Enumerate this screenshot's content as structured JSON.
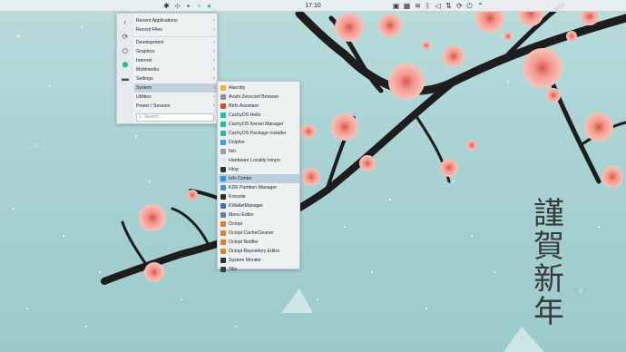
{
  "panel": {
    "clock": "17:10",
    "left_icons": [
      "application-launcher-icon",
      "pin-icon",
      "terminal-icon",
      "window-icon",
      "cachyos-icon"
    ],
    "tray_icons": [
      "clipboard-icon",
      "package-icon",
      "wifi-icon",
      "bluetooth-icon",
      "volume-icon",
      "network-icon",
      "updates-icon",
      "power-icon",
      "expand-icon"
    ]
  },
  "launcher": {
    "side_icons": [
      "back-icon",
      "refresh-icon",
      "power-icon",
      "cachyos-logo-icon",
      "display-icon"
    ],
    "items": [
      {
        "label": "Recent Applications"
      },
      {
        "label": "Recent Files"
      },
      {
        "label": "Development"
      },
      {
        "label": "Graphics"
      },
      {
        "label": "Internet"
      },
      {
        "label": "Multimedia"
      },
      {
        "label": "Settings"
      },
      {
        "label": "System"
      },
      {
        "label": "Utilities"
      },
      {
        "label": "Power / Session"
      }
    ],
    "search_placeholder": "Search...",
    "active_item": "System"
  },
  "submenu": {
    "items": [
      {
        "label": "Alacritty",
        "color": "#f3b233"
      },
      {
        "label": "Avahi Zeroconf Browser",
        "color": "#8a8f94"
      },
      {
        "label": "Btrfs Assistant",
        "color": "#d94a3c"
      },
      {
        "label": "CachyOS Hello",
        "color": "#1dbf9e"
      },
      {
        "label": "CachyOS Kernel Manager",
        "color": "#1dbf9e"
      },
      {
        "label": "CachyOS Package Installer",
        "color": "#1dbf9e"
      },
      {
        "label": "Dolphin",
        "color": "#3d9ee0"
      },
      {
        "label": "fish",
        "color": "#9a9fa4"
      },
      {
        "label": "Hardware Locality lstopo",
        "color": "#e8e8e8"
      },
      {
        "label": "Htop",
        "color": "#2d2f31"
      },
      {
        "label": "Info Center",
        "color": "#3d8fdc"
      },
      {
        "label": "KDE Partition Manager",
        "color": "#3d8fdc"
      },
      {
        "label": "Konsole",
        "color": "#2d2f31"
      },
      {
        "label": "KWalletManager",
        "color": "#3d6fc4"
      },
      {
        "label": "Menu Editor",
        "color": "#6c7d8b"
      },
      {
        "label": "Octopi",
        "color": "#e07e2f"
      },
      {
        "label": "Octopi CacheCleaner",
        "color": "#e07e2f"
      },
      {
        "label": "Octopi Notifier",
        "color": "#e07e2f"
      },
      {
        "label": "Octopi Repository Editor",
        "color": "#e07e2f"
      },
      {
        "label": "System Monitor",
        "color": "#2d2f31"
      },
      {
        "label": "Tilix",
        "color": "#3b3f43"
      }
    ],
    "highlighted": "Info Center"
  },
  "wallpaper": {
    "calligraphy": [
      "謹",
      "賀",
      "新",
      "年"
    ],
    "blossom_color": "#f0938a",
    "branch_color": "#1d1d1d"
  }
}
